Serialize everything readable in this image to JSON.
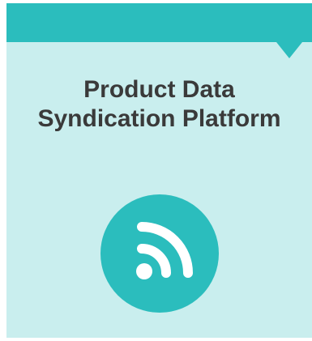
{
  "card": {
    "title_line1": "Product Data",
    "title_line2": "Syndication Platform",
    "icon": "rss-feed-icon"
  },
  "colors": {
    "accent": "#2bbdbd",
    "card_background": "#c9eeee",
    "title_text": "#3a3a3a",
    "icon_glyph": "#ffffff"
  }
}
